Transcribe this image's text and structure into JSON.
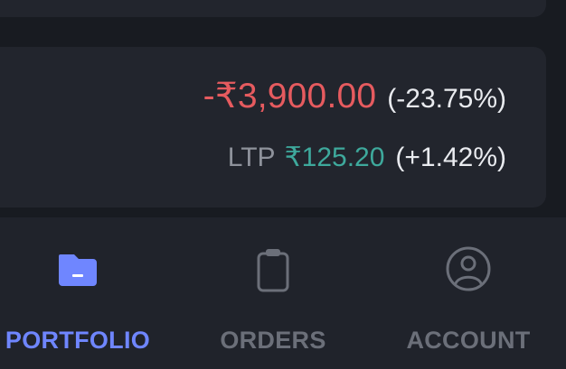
{
  "holding": {
    "pnl_value": "-₹3,900.00",
    "pnl_percent": "(-23.75%)",
    "ltp_label": "LTP",
    "ltp_value": "₹125.20",
    "ltp_change": "(+1.42%)"
  },
  "colors": {
    "loss": "#e65b5f",
    "gain": "#3ea99c",
    "active_tab": "#6f86ff",
    "inactive_tab": "#6b6f79"
  },
  "bottom_nav": {
    "active": "PORTFOLIO",
    "items": [
      {
        "label": "PORTFOLIO",
        "icon": "folder-icon"
      },
      {
        "label": "ORDERS",
        "icon": "clipboard-icon"
      },
      {
        "label": "ACCOUNT",
        "icon": "user-circle-icon"
      }
    ]
  }
}
